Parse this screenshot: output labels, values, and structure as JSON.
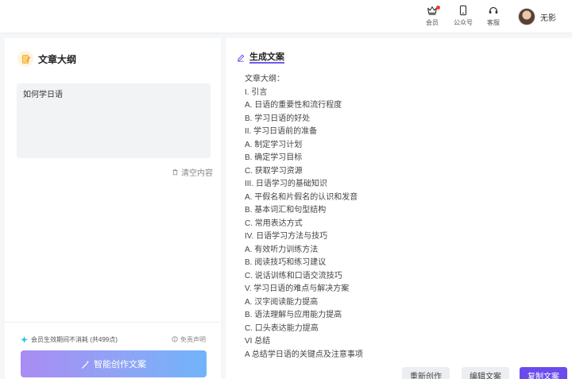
{
  "topbar": {
    "items": [
      {
        "label": "会员",
        "icon": "crown-icon",
        "has_badge": true
      },
      {
        "label": "公众号",
        "icon": "phone-icon",
        "has_badge": false
      },
      {
        "label": "客服",
        "icon": "headset-icon",
        "has_badge": false
      }
    ],
    "user_name": "无影"
  },
  "left": {
    "title": "文章大纲",
    "topic_value": "如何学日语",
    "clear_label": "清空内容",
    "member_note": "会员生效期间不消耗 (共499点)",
    "disclaimer_label": "免责声明",
    "generate_label": "智能创作文案"
  },
  "right": {
    "title": "生成文案",
    "outline_lines": [
      "文章大纲：",
      "I. 引言",
      "A. 日语的重要性和流行程度",
      "B. 学习日语的好处",
      "II. 学习日语前的准备",
      "A. 制定学习计划",
      "B. 确定学习目标",
      "C. 获取学习资源",
      "III. 日语学习的基础知识",
      "A. 平假名和片假名的认识和发音",
      "B. 基本词汇和句型结构",
      "C. 常用表达方式",
      "IV. 日语学习方法与技巧",
      "A. 有效听力训练方法",
      "B. 阅读技巧和练习建议",
      "C. 说话训练和口语交流技巧",
      "V. 学习日语的难点与解决方案",
      "A. 汉字阅读能力提高",
      "B. 语法理解与应用能力提高",
      "C. 口头表达能力提高",
      "VI 总结",
      "A 总结学日语的关键点及注意事项"
    ],
    "buttons": {
      "regenerate": "重新创作",
      "edit": "编辑文案",
      "copy": "复制文案"
    }
  },
  "colors": {
    "accent": "#6a4cec",
    "badge": "#f03a3a",
    "gem": "#27c6d4"
  }
}
